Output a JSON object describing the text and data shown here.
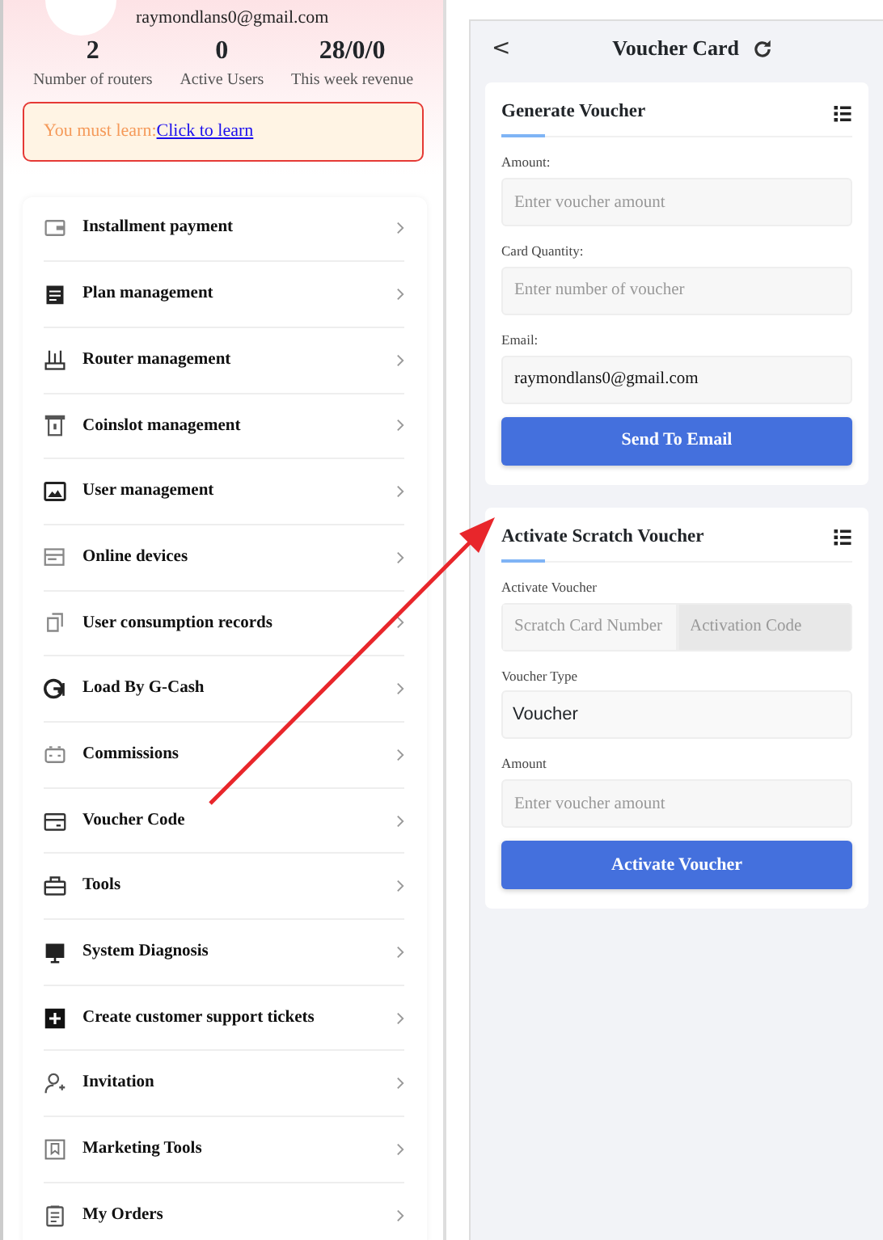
{
  "profile": {
    "email": "raymondlans0@gmail.com"
  },
  "stats": [
    {
      "value": "2",
      "label": "Number of routers"
    },
    {
      "value": "0",
      "label": "Active Users"
    },
    {
      "value": "28/0/0",
      "label": "This week revenue"
    }
  ],
  "notice": {
    "text": "You must learn:",
    "link": "Click to learn"
  },
  "menu": [
    {
      "label": "Installment payment"
    },
    {
      "label": "Plan management"
    },
    {
      "label": "Router management"
    },
    {
      "label": "Coinslot management"
    },
    {
      "label": "User management"
    },
    {
      "label": "Online devices"
    },
    {
      "label": "User consumption records"
    },
    {
      "label": "Load By G-Cash"
    },
    {
      "label": "Commissions"
    },
    {
      "label": "Voucher Code"
    },
    {
      "label": "Tools"
    },
    {
      "label": "System Diagnosis"
    },
    {
      "label": "Create customer support tickets"
    },
    {
      "label": "Invitation"
    },
    {
      "label": "Marketing Tools"
    },
    {
      "label": "My Orders"
    }
  ],
  "header": {
    "back": "<",
    "title": "Voucher Card"
  },
  "generate": {
    "title": "Generate Voucher",
    "fields": [
      {
        "label": "Amount:",
        "placeholder": "Enter voucher amount"
      },
      {
        "label": "Card Quantity:",
        "placeholder": "Enter number of voucher"
      },
      {
        "label": "Email:",
        "value": "raymondlans0@gmail.com"
      }
    ],
    "button": "Send To Email"
  },
  "activate": {
    "title": "Activate Scratch Voucher",
    "voucher_label": "Activate Voucher",
    "card_placeholder": "Scratch Card Number",
    "code_placeholder": "Activation Code",
    "type_label": "Voucher Type",
    "type_value": "Voucher",
    "amount_label": "Amount",
    "amount_placeholder": "Enter voucher amount",
    "button": "Activate Voucher"
  }
}
